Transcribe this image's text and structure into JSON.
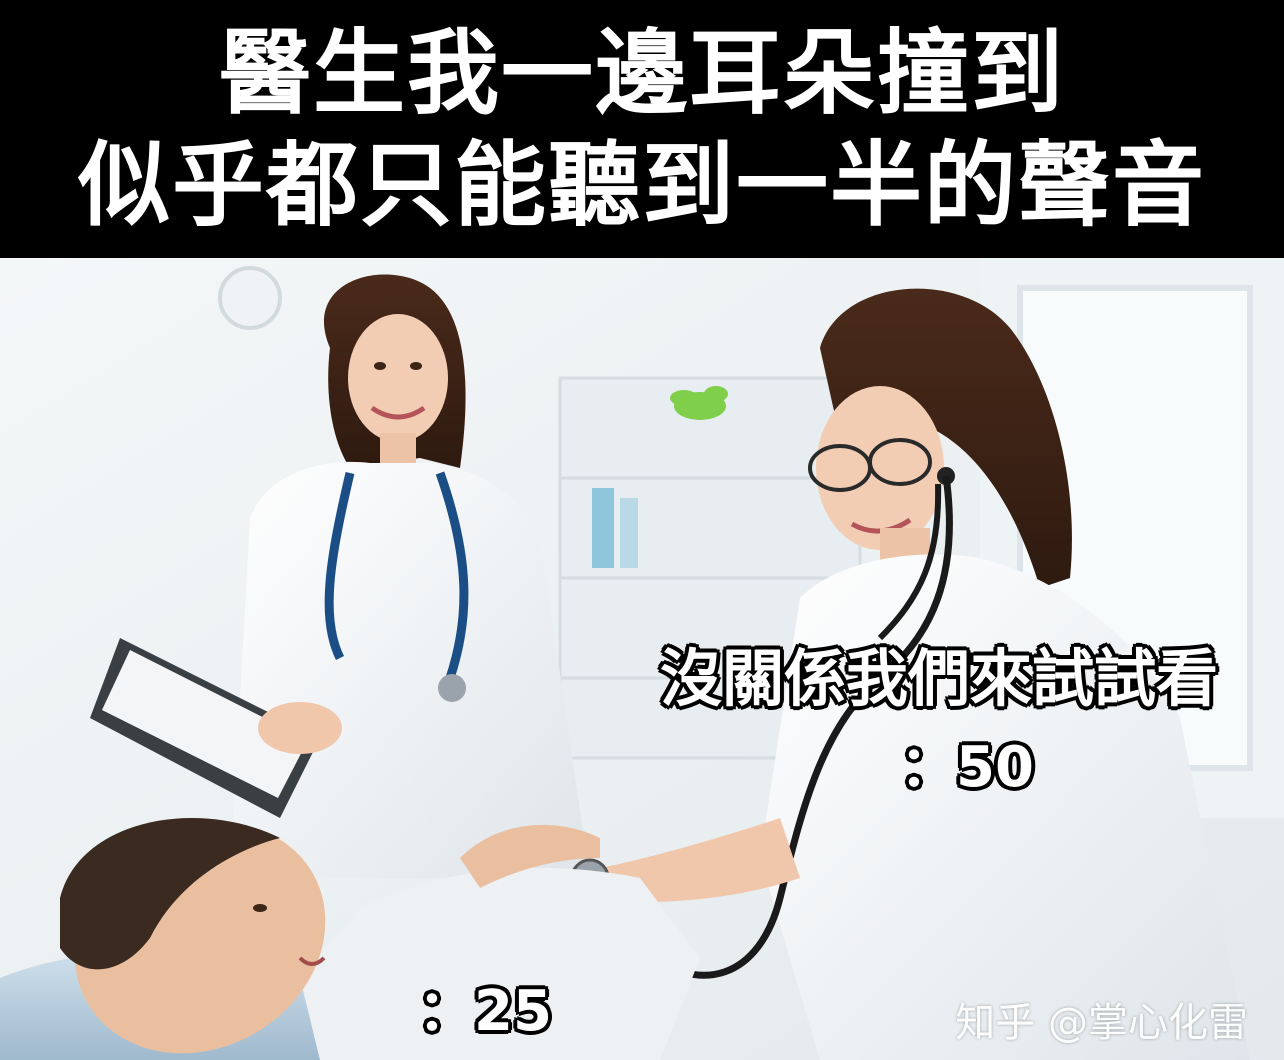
{
  "banner": {
    "line1": "醫生我一邊耳朵撞到",
    "line2": "似乎都只能聽到一半的聲音"
  },
  "captions": {
    "doctor_speech": "沒關係我們來試試看",
    "doctor_value": "：50",
    "patient_value": "：25"
  },
  "watermark": "知乎 @掌心化雷"
}
